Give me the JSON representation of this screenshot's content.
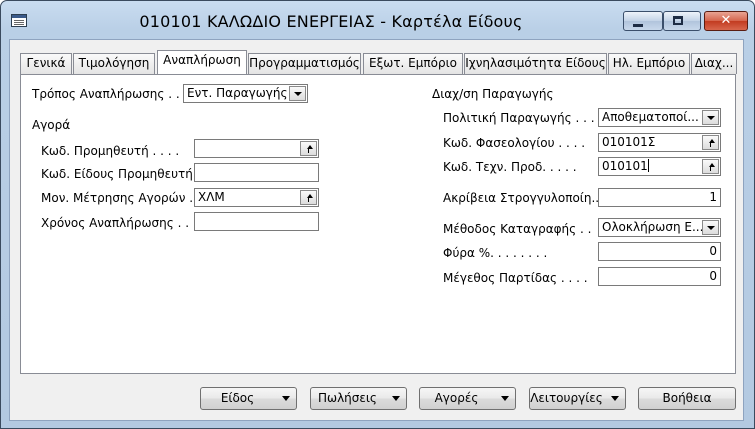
{
  "window": {
    "title": "010101 ΚΑΛΩΔΙΟ ΕΝΕΡΓΕΙΑΣ - Καρτέλα Είδους",
    "controls": {
      "minimize": "minimize",
      "maximize": "maximize",
      "close": "✕"
    }
  },
  "tabs": [
    {
      "label": "Γενικά"
    },
    {
      "label": "Τιμολόγηση"
    },
    {
      "label": "Αναπλήρωση"
    },
    {
      "label": "Προγραμματισμός"
    },
    {
      "label": "Εξωτ. Εμπόριο"
    },
    {
      "label": "Ιχνηλασιμότητα Είδους"
    },
    {
      "label": "Ηλ. Εμπόριο"
    },
    {
      "label": "Διαχ..."
    }
  ],
  "active_tab": "Αναπλήρωση",
  "left": {
    "replenishment_method_label": "Τρόπος Αναπλήρωσης . .",
    "replenishment_method_value": "Εντ. Παραγωγής",
    "purchase_section": "Αγορά",
    "vendor_code_label": "Κωδ. Προμηθευτή . . . .",
    "vendor_code_value": "",
    "vendor_item_code_label": "Κωδ. Είδους Προμηθευτή .",
    "vendor_item_code_value": "",
    "purch_uom_label": "Μον. Μέτρησης Αγορών .",
    "purch_uom_value": "ΧΛΜ",
    "lead_time_label": "Χρόνος Αναπλήρωσης . .",
    "lead_time_value": ""
  },
  "right": {
    "section": "Διαχ/ση Παραγωγής",
    "mfg_policy_label": "Πολιτική Παραγωγής . . .",
    "mfg_policy_value": "Αποθεματοποί...",
    "routing_label": "Κωδ. Φασεολογίου . . . .",
    "routing_value": "010101Σ",
    "bom_label": "Κωδ. Τεχν. Προδ. . . . .",
    "bom_value": "010101",
    "rounding_label": "Ακρίβεια Στρογγυλοποίη...",
    "rounding_value": "1",
    "flushing_label": "Μέθοδος Καταγραφής . .",
    "flushing_value": "Ολοκλήρωση Ε...",
    "scrap_label": "Φύρα %. . . . . . . .",
    "scrap_value": "0",
    "lot_size_label": "Μέγεθος Παρτίδας . . . .",
    "lot_size_value": "0"
  },
  "buttons": {
    "item": "Είδος",
    "sales": "Πωλήσεις",
    "purchases": "Αγορές",
    "functions": "Λειτουργίες",
    "help": "Βοήθεια"
  }
}
